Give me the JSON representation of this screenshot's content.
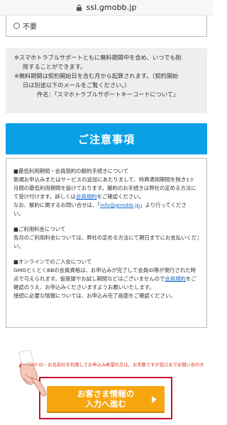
{
  "browser": {
    "url": "ssl.gmobb.jp"
  },
  "option": {
    "label": "不要"
  },
  "note": {
    "line1": "※スマホトラブルサポートともに無料期間中を含め、いつでも削",
    "line2": "除することができます。",
    "line3": "※無料期間は契約開始日を含む月から起算されます。（契約開始",
    "line4": "日は別途以下のメールをご覧ください。）",
    "line5": "件名：「スマホトラブルサポートキーコードについて」"
  },
  "caution": {
    "title": "ご注意事項"
  },
  "terms": {
    "s1_title": "■最低利用期間・会員契約の解約手続きについて",
    "s1_l1": "新規お申込みまたはサービスの追加にあたりまして、特典適用期間を除き1ヶ",
    "s1_l2": "月間の最低利用期間を設けております。解約のお手続きは弊社の定める方法に",
    "s1_l3_a": "て受け付けます。詳しくは",
    "s1_l3_link": "会員規約",
    "s1_l3_b": "をご確認ください。",
    "s1_l4_a": "なお、解約に関するお問い合せは、「",
    "s1_l4_link": "info@gmobb.jp",
    "s1_l4_b": "」より行ってくださ",
    "s1_l5": "い。",
    "s2_title": "■ご利用料金について",
    "s2_l1": "各月のご利用料金については、弊社の定める方法にて期日までにお支払いくださ",
    "s2_l2": "い。",
    "s3_title": "■オンラインでのご入会について",
    "s3_l1": "GMOとくとくBBの会員資格は、お申込みが完了して会員ID等が発行された時",
    "s3_l2": "点で与えられます。仮登録やお試し期間などはございませんので",
    "s3_l2_link": "会員規約",
    "s3_l2_b": "をご",
    "s3_l3": "確認のうえ、お申込みくださいますようお願いいたします。",
    "s3_l4": "接続に必要な情報については、お申込み完了画面をご確認ください。"
  },
  "warning": {
    "text": "GMO ID・お名前IDを利用してお申込み希望の方は、お手数ですが窓口までお問い合わせ"
  },
  "cta": {
    "line1": "お客さま情報の",
    "line2": "入力へ進む"
  },
  "colors": {
    "header_blue": "#0aa0e6",
    "cta_orange": "#f7a60e",
    "frame_red": "#c8102e",
    "warning_red": "#d9301f",
    "link_blue": "#1a6bd0"
  }
}
